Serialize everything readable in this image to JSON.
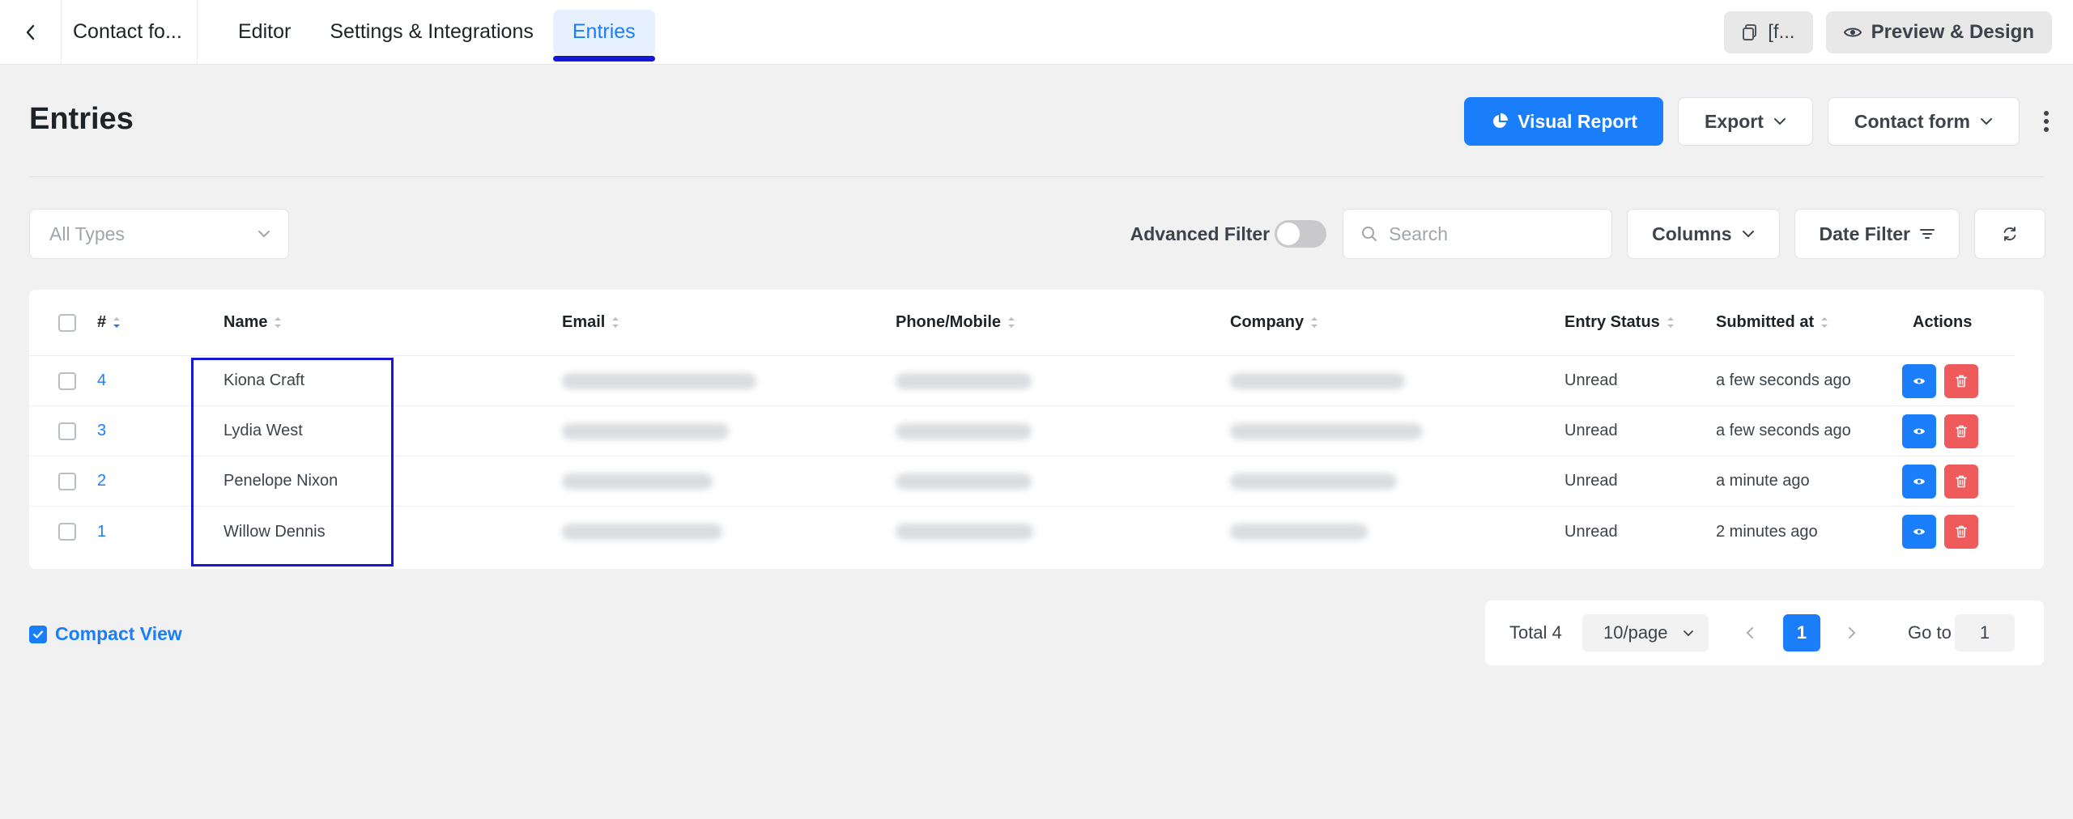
{
  "topbar": {
    "form_title": "Contact fo...",
    "tabs": [
      {
        "label": "Editor"
      },
      {
        "label": "Settings & Integrations"
      },
      {
        "label": "Entries"
      }
    ],
    "shortcode_label": "[f...",
    "preview_label": "Preview & Design"
  },
  "header": {
    "title": "Entries",
    "visual_report_label": "Visual Report",
    "export_label": "Export",
    "form_select_label": "Contact form"
  },
  "filters": {
    "type_select_value": "All Types",
    "advanced_filter_label": "Advanced Filter",
    "advanced_filter_on": false,
    "search_placeholder": "Search",
    "columns_label": "Columns",
    "date_filter_label": "Date Filter"
  },
  "table": {
    "columns": {
      "id": "#",
      "name": "Name",
      "email": "Email",
      "phone": "Phone/Mobile",
      "company": "Company",
      "status": "Entry Status",
      "submitted": "Submitted at",
      "actions": "Actions"
    },
    "rows": [
      {
        "id": "4",
        "name": "Kiona Craft",
        "status": "Unread",
        "submitted": "a few seconds ago"
      },
      {
        "id": "3",
        "name": "Lydia West",
        "status": "Unread",
        "submitted": "a few seconds ago"
      },
      {
        "id": "2",
        "name": "Penelope Nixon",
        "status": "Unread",
        "submitted": "a minute ago"
      },
      {
        "id": "1",
        "name": "Willow Dennis",
        "status": "Unread",
        "submitted": "2 minutes ago"
      }
    ]
  },
  "footer": {
    "compact_view_label": "Compact View",
    "compact_view_checked": true,
    "total_label": "Total 4",
    "page_size": "10/page",
    "current_page": "1",
    "goto_label": "Go to",
    "goto_value": "1"
  },
  "colors": {
    "accent": "#1a7efb",
    "danger": "#ef5a5a",
    "highlight": "#1616d6"
  },
  "icons": {
    "back": "chevron-left-icon",
    "shortcode": "copy-icon",
    "preview": "eye-icon",
    "report": "pie-chart-icon",
    "search": "search-icon",
    "refresh": "refresh-icon",
    "view": "eye-icon",
    "delete": "trash-icon"
  }
}
